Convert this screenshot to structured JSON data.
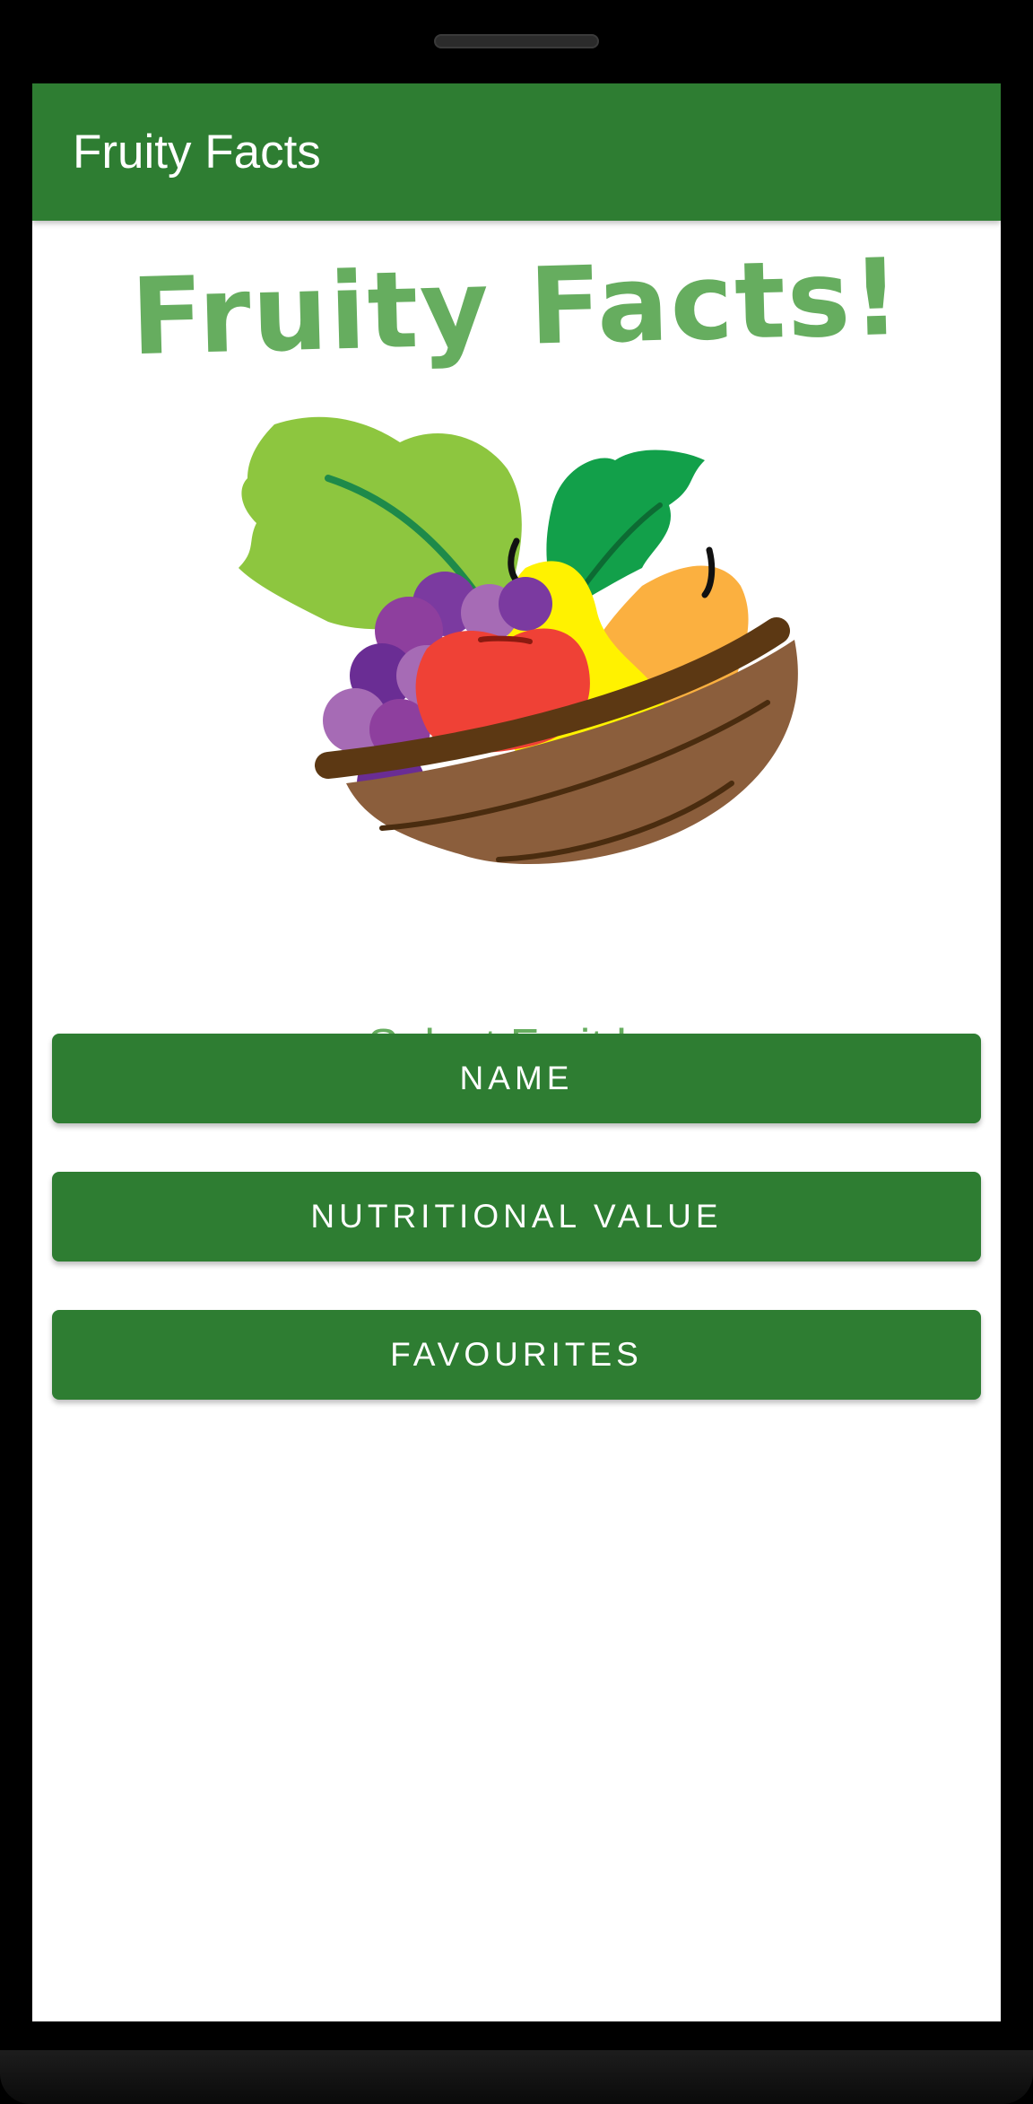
{
  "app_bar": {
    "title": "Fruity Facts"
  },
  "hero": {
    "title": "Fruity Facts!",
    "image_name": "fruit-basket-illustration"
  },
  "selection": {
    "subtitle": "Select Fruit by",
    "buttons": {
      "name": "NAME",
      "nutritional_value": "NUTRITIONAL VALUE",
      "favourites": "FAVOURITES"
    }
  },
  "colors": {
    "primary": "#2e7d32",
    "accent_text": "#66ad5f",
    "background": "#ffffff"
  }
}
